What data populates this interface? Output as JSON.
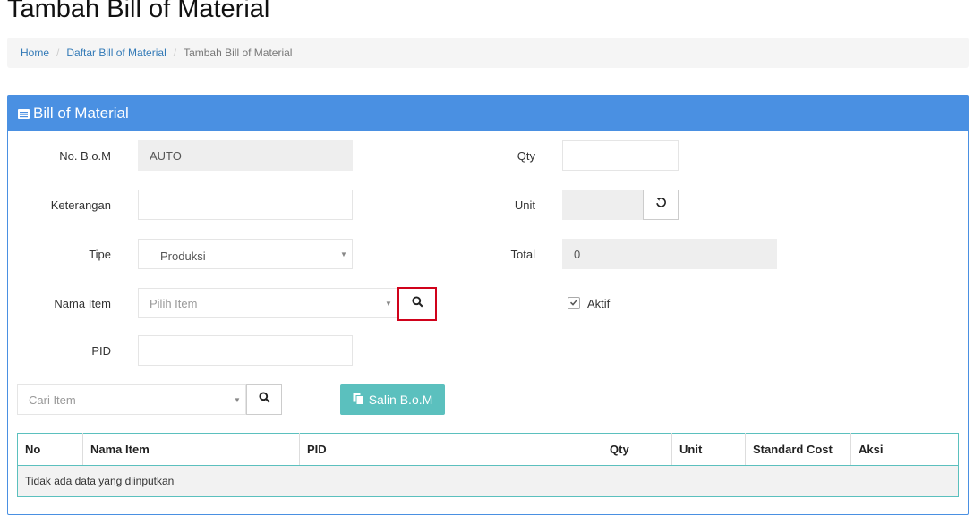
{
  "page": {
    "title": "Tambah Bill of Material"
  },
  "breadcrumb": {
    "items": [
      "Home",
      "Daftar Bill of Material",
      "Tambah Bill of Material"
    ],
    "separator": "/"
  },
  "panel": {
    "title": "Bill of Material",
    "icon": "list-icon",
    "header_color": "#4a90e2"
  },
  "form": {
    "no_bom": {
      "label": "No. B.o.M",
      "value": "AUTO"
    },
    "keterangan": {
      "label": "Keterangan",
      "value": ""
    },
    "tipe": {
      "label": "Tipe",
      "value": "Produksi"
    },
    "nama_item": {
      "label": "Nama Item",
      "placeholder": "Pilih Item"
    },
    "pid": {
      "label": "PID",
      "value": ""
    },
    "qty": {
      "label": "Qty",
      "value": ""
    },
    "unit": {
      "label": "Unit",
      "value": ""
    },
    "total": {
      "label": "Total",
      "value": "0"
    },
    "aktif": {
      "label": "Aktif",
      "checked": true
    }
  },
  "toolbar": {
    "search_placeholder": "Cari Item",
    "copy_button": "Salin B.o.M",
    "copy_button_color": "#5bc0be"
  },
  "table": {
    "columns": [
      "No",
      "Nama Item",
      "PID",
      "Qty",
      "Unit",
      "Standard Cost",
      "Aksi"
    ],
    "empty_message": "Tidak ada data yang diinputkan"
  },
  "highlight_color": "#d0021b"
}
